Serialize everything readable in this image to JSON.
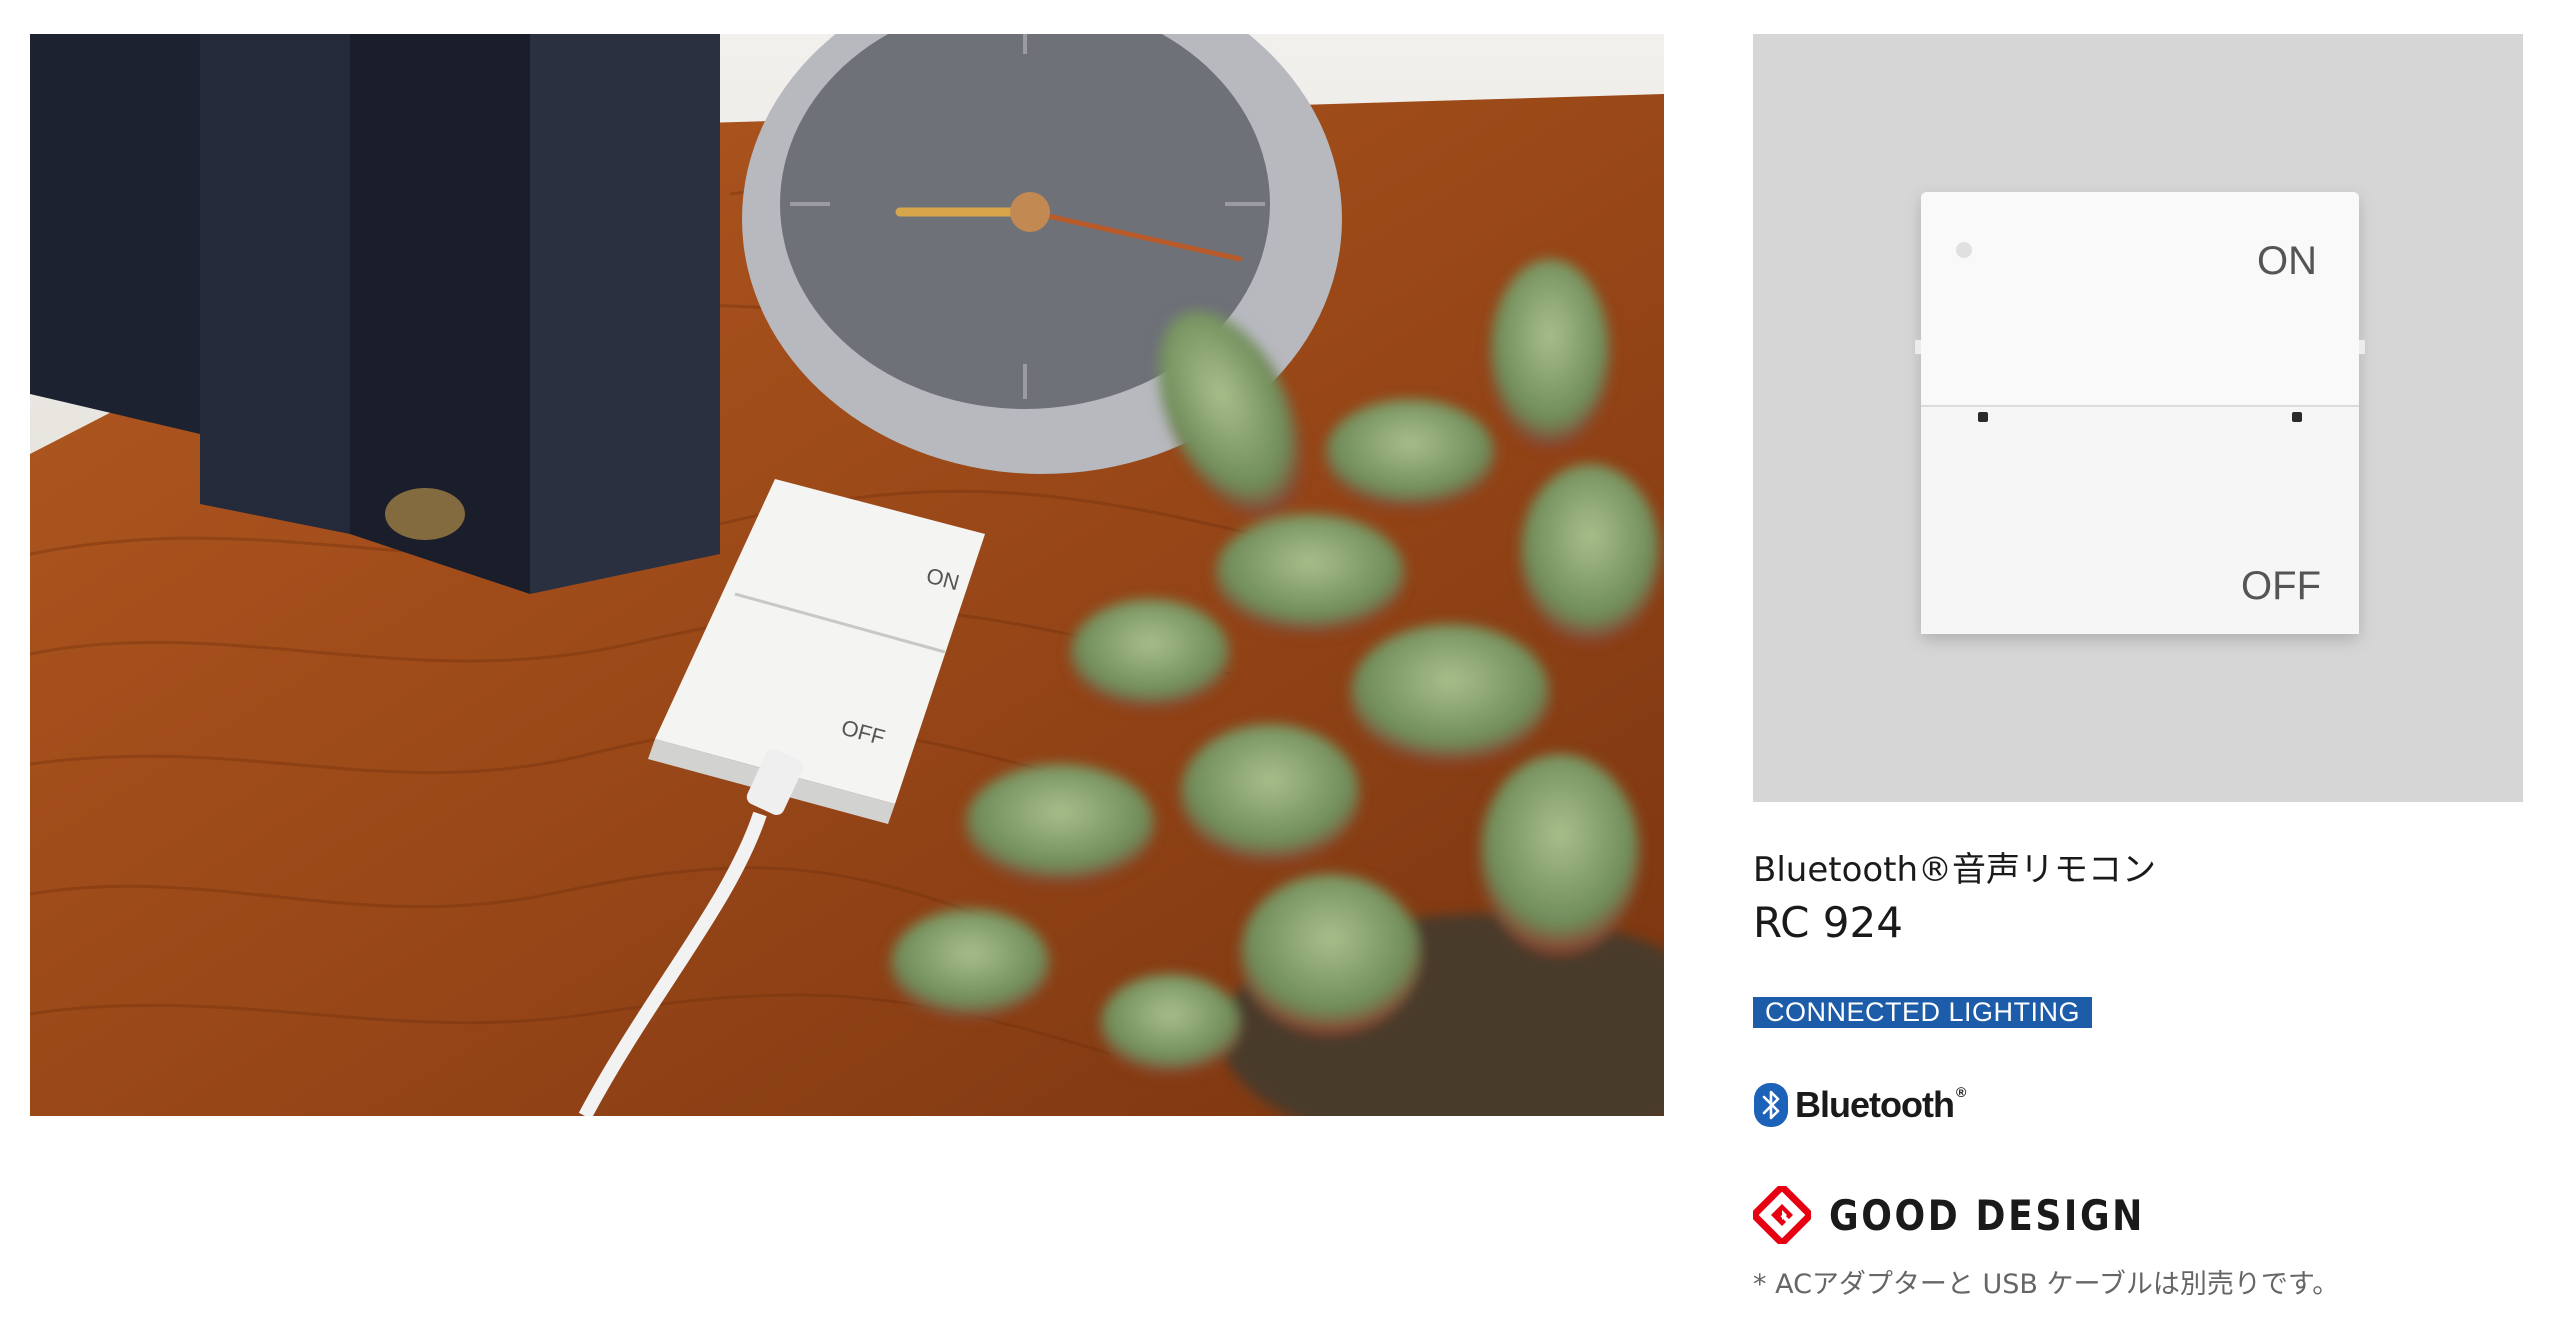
{
  "hero_photo": {
    "device": {
      "on_label": "ON",
      "off_label": "OFF"
    }
  },
  "product_photo": {
    "on_label": "ON",
    "off_label": "OFF"
  },
  "product": {
    "subtitle": "Bluetooth®音声リモコン",
    "model": "RC 924"
  },
  "badges": {
    "connected_lighting": "CONNECTED LIGHTING",
    "bluetooth": "Bluetooth",
    "good_design": "GOOD DESIGN"
  },
  "footnote": "* ACアダプターと USB ケーブルは別売りです。",
  "colors": {
    "connected_lighting_bg": "#1c5ca8",
    "bluetooth_blue": "#1c62b9",
    "good_design_red": "#e60012",
    "panel_gray": "#d6d6d6"
  },
  "icons": [
    "bluetooth-icon",
    "good-design-g-mark-icon"
  ]
}
